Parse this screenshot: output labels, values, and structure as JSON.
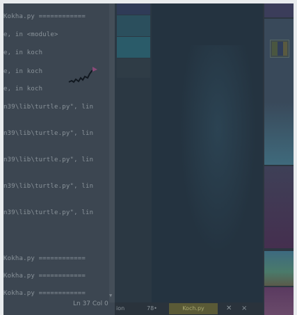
{
  "shell": {
    "lines": [
      "Kokha.py ============",
      "e, in <module>",
      "e, in koch",
      "e, in koch",
      "e, in koch",
      "n39\\lib\\turtle.py\", lin",
      "n39\\lib\\turtle.py\", lin",
      "n39\\lib\\turtle.py\", lin",
      "n39\\lib\\turtle.py\", lin",
      "n39\\lib\\turtle.py\", lin",
      "Kokha.py ============",
      "Kokha.py ============",
      "Kokha.py ============"
    ],
    "status": "Ln 37  Col 0"
  },
  "taskbar": {
    "item_left": "ion",
    "item_mid": "78•",
    "badge": "Koch.py",
    "icon_a": "✕",
    "icon_b": "×"
  },
  "turtle_icon": "turtle-icon",
  "colors": {
    "panel": "#3c4651",
    "text": "#8a939a",
    "dark": "#243340"
  }
}
